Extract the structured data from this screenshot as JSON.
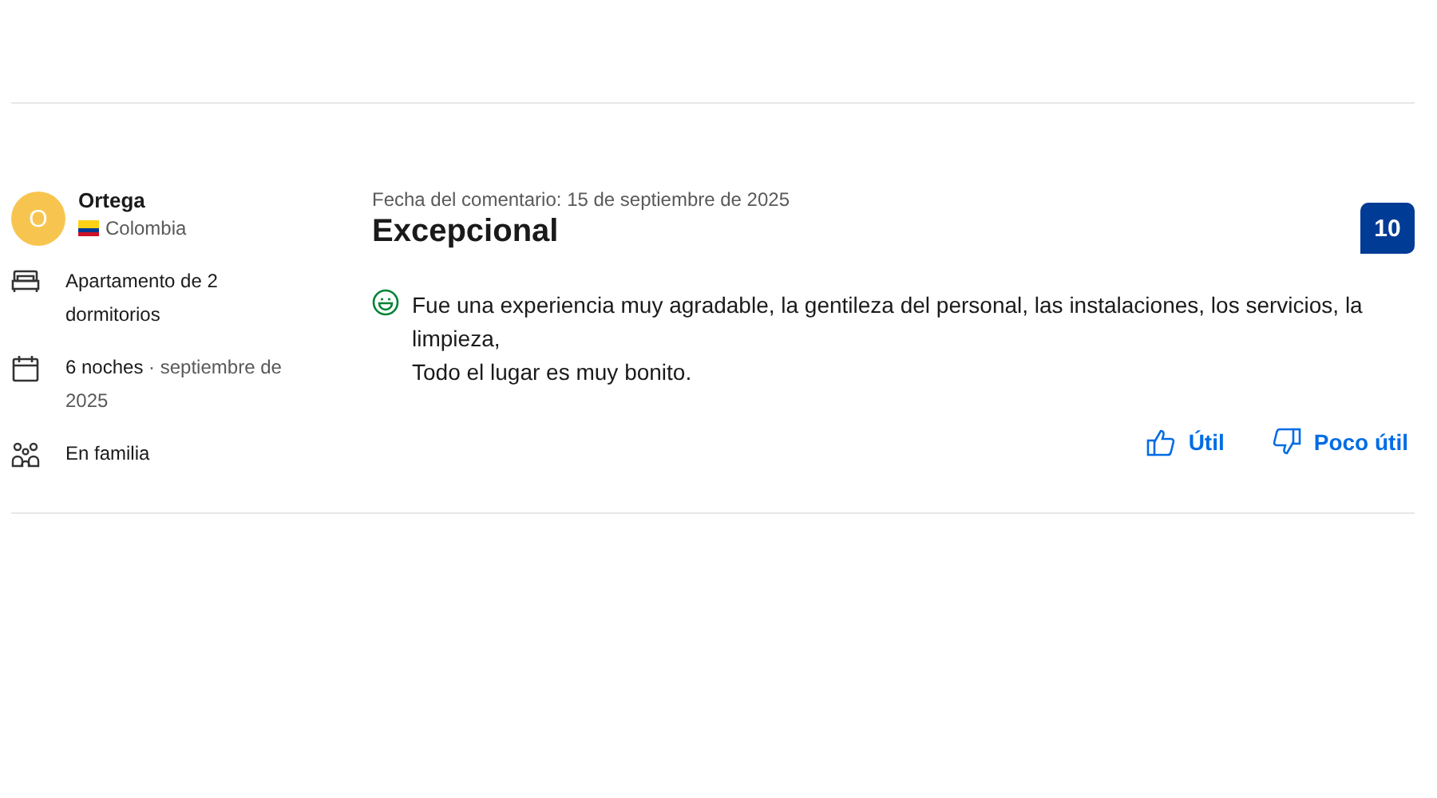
{
  "reviewer": {
    "initial": "O",
    "name": "Ortega",
    "country": "Colombia"
  },
  "stay": [
    {
      "kind": "room",
      "text": "Apartamento de 2 dormitorios"
    },
    {
      "kind": "dates",
      "text": "6 noches",
      "detail": "· septiembre de 2025"
    },
    {
      "kind": "group",
      "text": "En familia"
    }
  ],
  "review": {
    "date": "Fecha del comentario: 15 de septiembre de 2025",
    "title": "Excepcional",
    "score": "10",
    "text": "Fue una experiencia muy agradable, la gentileza del personal, las instalaciones, los servicios, la limpieza,\nTodo el lugar es muy bonito."
  },
  "actions": [
    {
      "kind": "up",
      "label": "Útil"
    },
    {
      "kind": "down",
      "label": "Poco útil"
    }
  ]
}
